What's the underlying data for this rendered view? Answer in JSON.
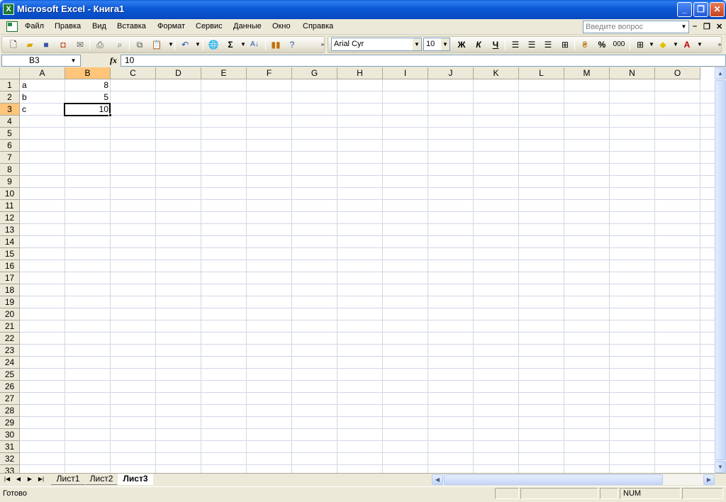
{
  "window": {
    "title": "Microsoft Excel - Книга1",
    "app_icon": "X",
    "minimize": "_",
    "maximize": "❐",
    "close": "✕"
  },
  "menu": {
    "items": [
      "Файл",
      "Правка",
      "Вид",
      "Вставка",
      "Формат",
      "Сервис",
      "Данные",
      "Окно",
      "Справка"
    ],
    "help_placeholder": "Введите вопрос",
    "doc_minimize": "–",
    "doc_restore": "❐",
    "doc_close": "✕"
  },
  "toolbar": {
    "standard_icons": [
      "new-icon",
      "open-icon",
      "save-icon",
      "permission-icon",
      "email-icon",
      "print-icon",
      "print-preview-icon",
      "spelling-icon",
      "copy-icon",
      "paste-icon",
      "undo-icon",
      "hyperlink-icon",
      "autosum-icon",
      "sort-icon",
      "chart-icon",
      "help-icon"
    ],
    "autosum_label": "Σ",
    "font_name": "Arial Cyr",
    "font_size": "10",
    "bold": "Ж",
    "italic": "К",
    "underline": "Ч",
    "percent": "%",
    "thousands": "000"
  },
  "formula_bar": {
    "name_box": "B3",
    "fx_label": "fx",
    "formula": "10"
  },
  "grid": {
    "columns": [
      "A",
      "B",
      "C",
      "D",
      "E",
      "F",
      "G",
      "H",
      "I",
      "J",
      "K",
      "L",
      "M",
      "N",
      "O"
    ],
    "rows": [
      "1",
      "2",
      "3",
      "4",
      "5",
      "6",
      "7",
      "8",
      "9",
      "10",
      "11",
      "12",
      "13",
      "14",
      "15",
      "16",
      "17",
      "18",
      "19",
      "20",
      "21",
      "22",
      "23",
      "24",
      "25",
      "26",
      "27",
      "28",
      "29",
      "30",
      "31",
      "32",
      "33"
    ],
    "selected_column": "B",
    "selected_row": "3",
    "cells": [
      {
        "ref": "A1",
        "value": "a"
      },
      {
        "ref": "B1",
        "value": "8"
      },
      {
        "ref": "A2",
        "value": "b"
      },
      {
        "ref": "B2",
        "value": "5"
      },
      {
        "ref": "A3",
        "value": "c"
      },
      {
        "ref": "B3",
        "value": "10"
      }
    ]
  },
  "sheets": {
    "tabs": [
      "Лист1",
      "Лист2",
      "Лист3"
    ],
    "active": "Лист3"
  },
  "status": {
    "ready": "Готово",
    "num": "NUM"
  }
}
